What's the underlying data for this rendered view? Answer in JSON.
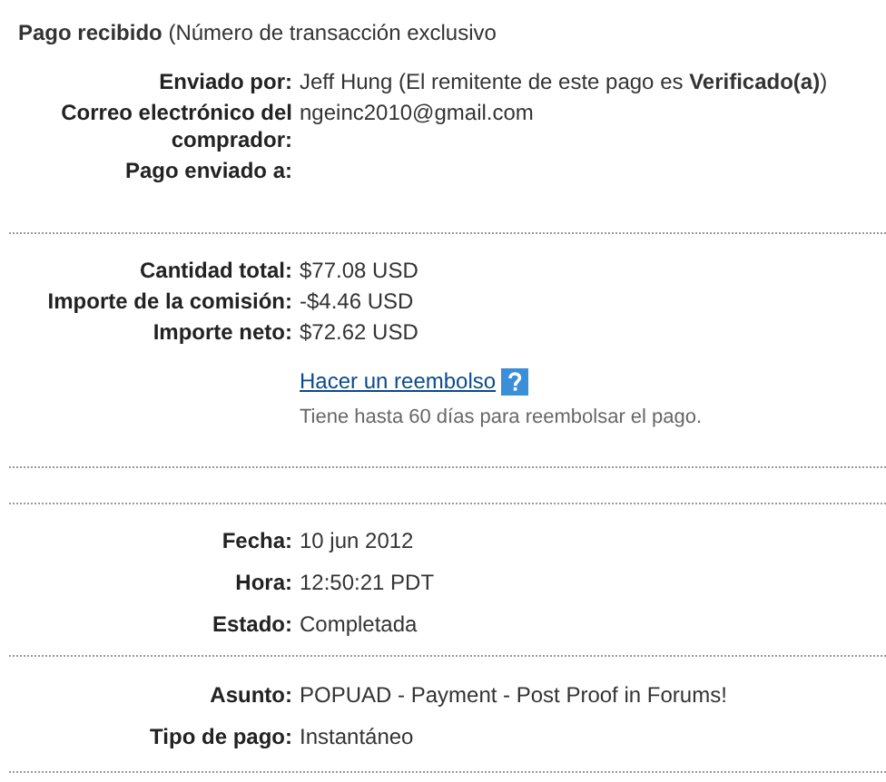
{
  "header": "**Pago recibido** (Número de transacción exclusivo",
  "sections": [
    {
      "kind": "details",
      "rows": [
        {
          "label": "Enviado por:",
          "value": "Jeff Hung (El remitente de este pago es **Verificado(a)**)"
        },
        {
          "label": "Correo electrónico del comprador:",
          "value": "ngeinc2010@gmail.com"
        },
        {
          "label": "Pago enviado a:",
          "value": ""
        }
      ]
    },
    {
      "kind": "details",
      "rows": [
        {
          "label": "Cantidad total:",
          "value": "$77.08 USD"
        },
        {
          "label": "Importe de la comisión:",
          "value": "-$4.46 USD"
        },
        {
          "label": "Importe neto:",
          "value": "$72.62 USD"
        }
      ],
      "refund": {
        "link": "Hacer un reembolso",
        "note": "Tiene hasta 60 días para reembolsar el pago."
      }
    },
    {
      "kind": "blank"
    },
    {
      "kind": "details",
      "rows": [
        {
          "label": "Fecha:",
          "value": "10 jun 2012"
        },
        {
          "label": "Hora:",
          "value": "12:50:21 PDT"
        },
        {
          "label": "Estado:",
          "value": "Completada"
        }
      ]
    },
    {
      "kind": "details",
      "rows": [
        {
          "label": "Asunto:",
          "value": "POPUAD - Payment - Post Proof in Forums!"
        },
        {
          "label": "Tipo de pago:",
          "value": "Instantáneo"
        }
      ]
    }
  ]
}
